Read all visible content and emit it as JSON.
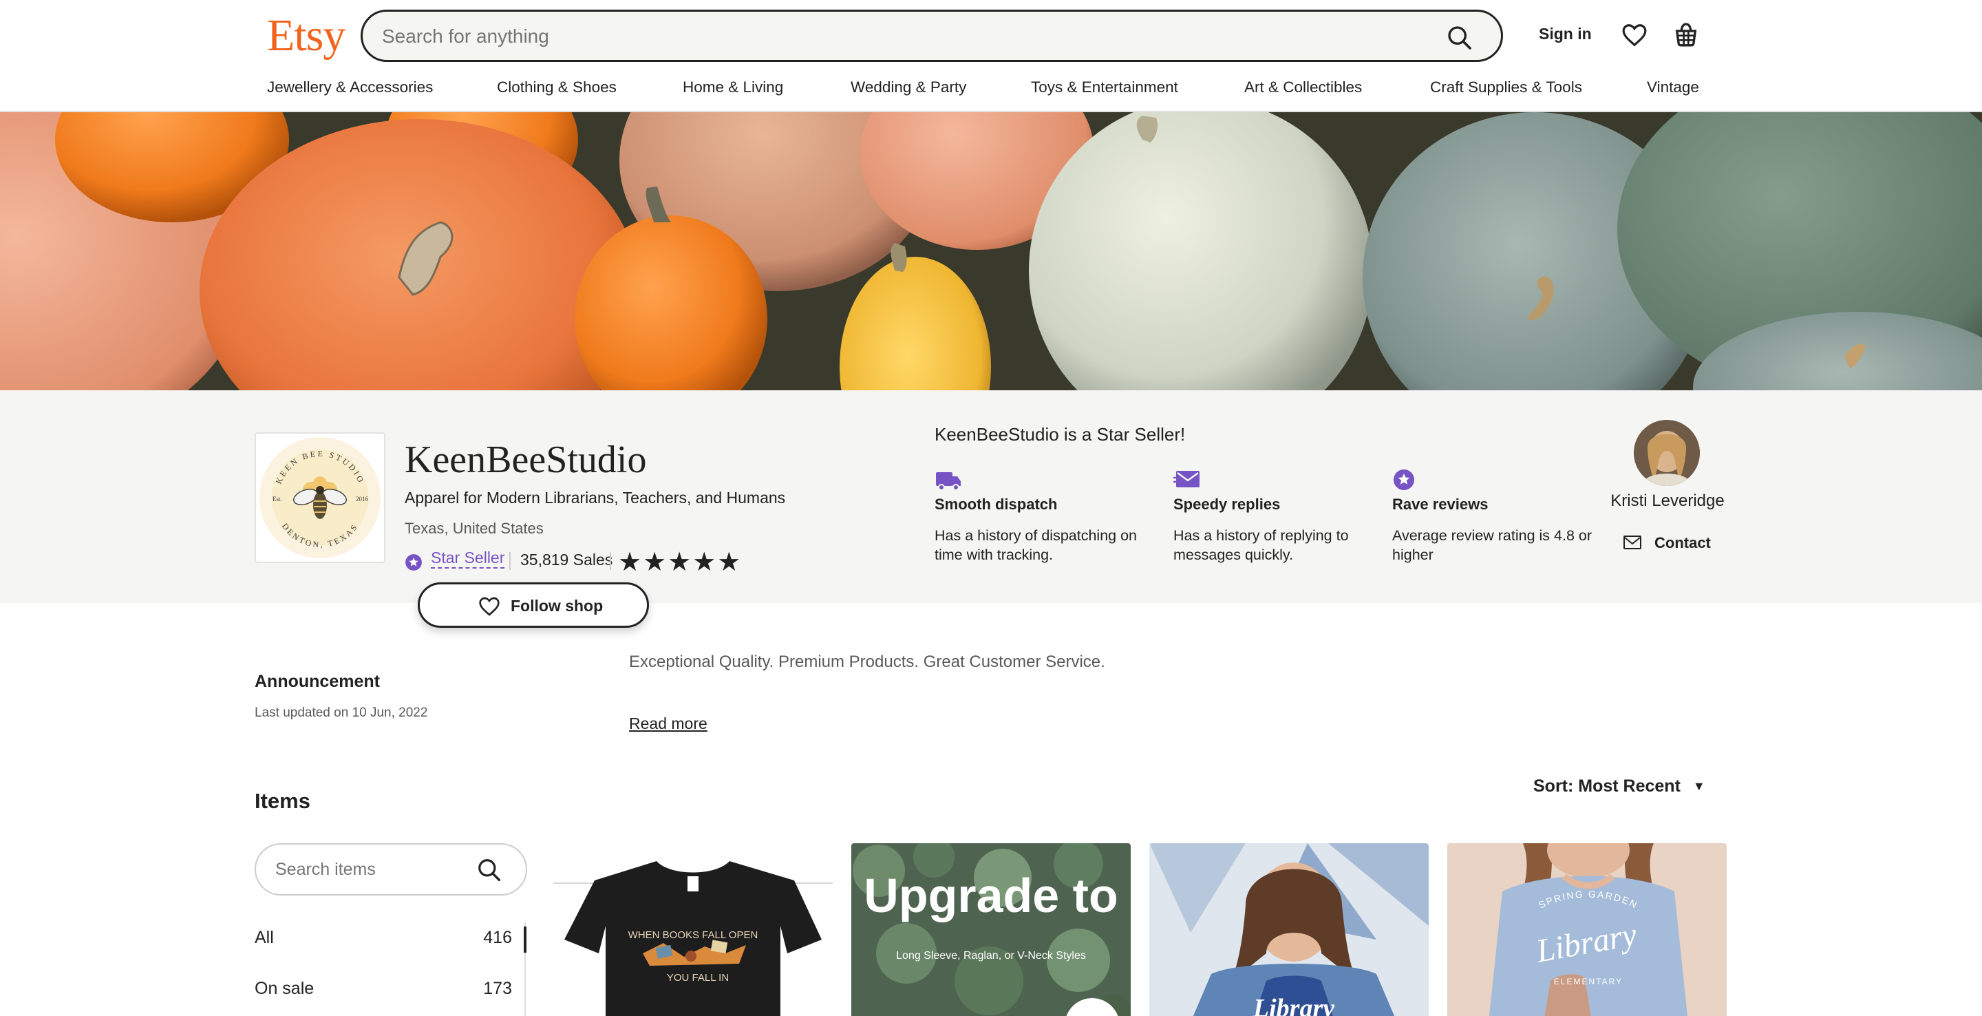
{
  "header": {
    "logo": "Etsy",
    "search_placeholder": "Search for anything",
    "sign_in": "Sign in",
    "categories": [
      "Jewellery & Accessories",
      "Clothing & Shoes",
      "Home & Living",
      "Wedding & Party",
      "Toys & Entertainment",
      "Art & Collectibles",
      "Craft Supplies & Tools",
      "Vintage"
    ]
  },
  "shop": {
    "name": "KeenBeeStudio",
    "tagline": "Apparel for Modern Librarians, Teachers, and Humans",
    "location": "Texas, United States",
    "star_seller_label": "Star Seller",
    "sales": "35,819 Sales",
    "rating_stars": 5,
    "follow_label": "Follow shop",
    "logo_text_top": "KEEN BEE STUDIO",
    "logo_text_bottom": "DENTON, TEXAS",
    "logo_est": "Est.",
    "logo_year": "2016"
  },
  "star_seller": {
    "title": "KeenBeeStudio is a Star Seller!",
    "badges": [
      {
        "icon": "truck-icon",
        "title": "Smooth dispatch",
        "desc": "Has a history of dispatching on time with tracking."
      },
      {
        "icon": "message-icon",
        "title": "Speedy replies",
        "desc": "Has a history of replying to messages quickly."
      },
      {
        "icon": "star-badge-icon",
        "title": "Rave reviews",
        "desc": "Average review rating is 4.8 or higher"
      }
    ]
  },
  "owner": {
    "name": "Kristi Leveridge",
    "contact_label": "Contact"
  },
  "announcement": {
    "title": "Announcement",
    "date": "Last updated on 10 Jun, 2022",
    "text": "Exceptional Quality. Premium Products. Great Customer Service.",
    "read_more": "Read more"
  },
  "items": {
    "title": "Items",
    "sort_label": "Sort: Most Recent",
    "search_placeholder": "Search items",
    "categories": [
      {
        "label": "All",
        "count": "416"
      },
      {
        "label": "On sale",
        "count": "173"
      }
    ],
    "listing_texts": {
      "card1_line1": "WHEN BOOKS FALL OPEN",
      "card1_line2": "YOU FALL IN",
      "card2_big": "Upgrade to",
      "card2_small": "Long Sleeve, Raglan, or V-Neck Styles",
      "card3_shirt": "Library",
      "card4_arc": "SPRING GARDEN",
      "card4_script": "Library",
      "card4_bottom": "ELEMENTARY"
    }
  },
  "colors": {
    "brand": "#f1641e",
    "star_seller": "#7754c5",
    "info_band": "#f5f5f3"
  }
}
